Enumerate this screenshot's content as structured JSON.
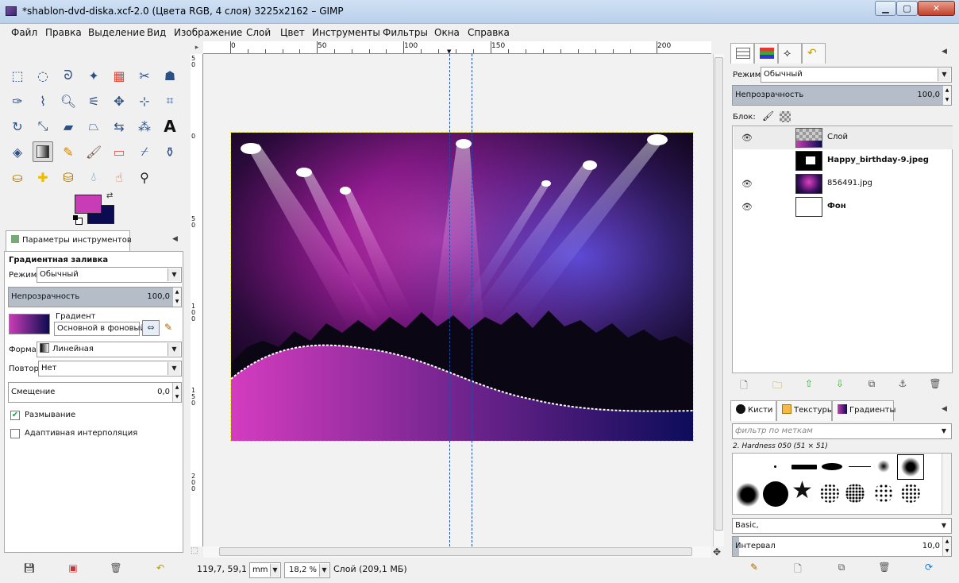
{
  "window": {
    "title": "*shablon-dvd-diska.xcf-2.0 (Цвета RGB, 4 слоя) 3225x2162 – GIMP",
    "min_label": "▁",
    "max_label": "▢",
    "close_label": "✕"
  },
  "menu": [
    "Файл",
    "Правка",
    "Выделение",
    "Вид",
    "Изображение",
    "Слой",
    "Цвет",
    "Инструменты",
    "Фильтры",
    "Окна",
    "Справка"
  ],
  "colors": {
    "foreground": "#c83cb6",
    "background": "#0b0b52",
    "accent": "#1a4fb0"
  },
  "tool_options": {
    "tab_label": "Параметры инструментов",
    "title": "Градиентная заливка",
    "mode_label": "Режим:",
    "mode_value": "Обычный",
    "opacity_label": "Непрозрачность",
    "opacity_value": "100,0",
    "gradient_label": "Градиент",
    "gradient_value": "Основной в фоновый",
    "shape_label": "Форма:",
    "shape_value": "Линейная",
    "repeat_label": "Повтор:",
    "repeat_value": "Нет",
    "offset_label": "Смещение",
    "offset_value": "0,0",
    "dithering_label": "Размывание",
    "dithering_checked": true,
    "adaptive_label": "Адаптивная интерполяция",
    "adaptive_checked": false
  },
  "ruler": {
    "h_labels": [
      "0",
      "50",
      "100",
      "150",
      "200"
    ],
    "v_labels": [
      "5\n0",
      "0",
      "5\n0",
      "1\n0\n0",
      "1\n5\n0",
      "2\n0\n0"
    ]
  },
  "status": {
    "coords": "119,7, 59,1",
    "unit": "mm",
    "zoom": "18,2 %",
    "info": "Слой (209,1 МБ)"
  },
  "layers": {
    "mode_label": "Режим:",
    "mode_value": "Обычный",
    "opacity_label": "Непрозрачность",
    "opacity_value": "100,0",
    "lock_label": "Блок:",
    "items": [
      {
        "name": "Слой",
        "visible": true,
        "bold": false
      },
      {
        "name": "Happy_birthday-9.jpeg",
        "visible": false,
        "bold": true
      },
      {
        "name": "856491.jpg",
        "visible": true,
        "bold": false
      },
      {
        "name": "Фон",
        "visible": true,
        "bold": true
      }
    ]
  },
  "brushes": {
    "tabs": [
      "Кисти",
      "Текстуры",
      "Градиенты"
    ],
    "filter_placeholder": "фильтр по меткам",
    "selected": "2. Hardness 050 (51 × 51)",
    "set": "Basic,",
    "spacing_label": "Интервал",
    "spacing_value": "10,0"
  }
}
